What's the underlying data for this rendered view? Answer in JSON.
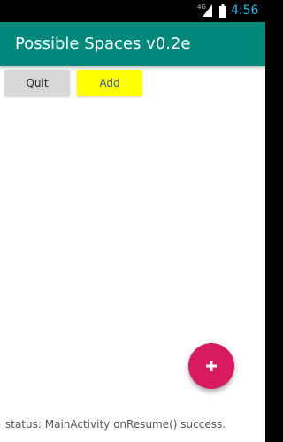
{
  "status_bar": {
    "network_label": "4G",
    "signal_icon": "signal-bars-icon",
    "battery_icon": "battery-icon",
    "time": "4:56",
    "time_color": "#33b5e5"
  },
  "app_bar": {
    "title": "Possible Spaces v0.2e",
    "background_color": "#00897b"
  },
  "toolbar": {
    "quit_label": "Quit",
    "add_label": "Add",
    "add_button_color": "#ffff00",
    "add_text_color": "#3f51b5"
  },
  "fab": {
    "icon": "plus-icon",
    "color": "#d81b60"
  },
  "footer": {
    "status_text": "status: MainActivity onResume() success."
  }
}
